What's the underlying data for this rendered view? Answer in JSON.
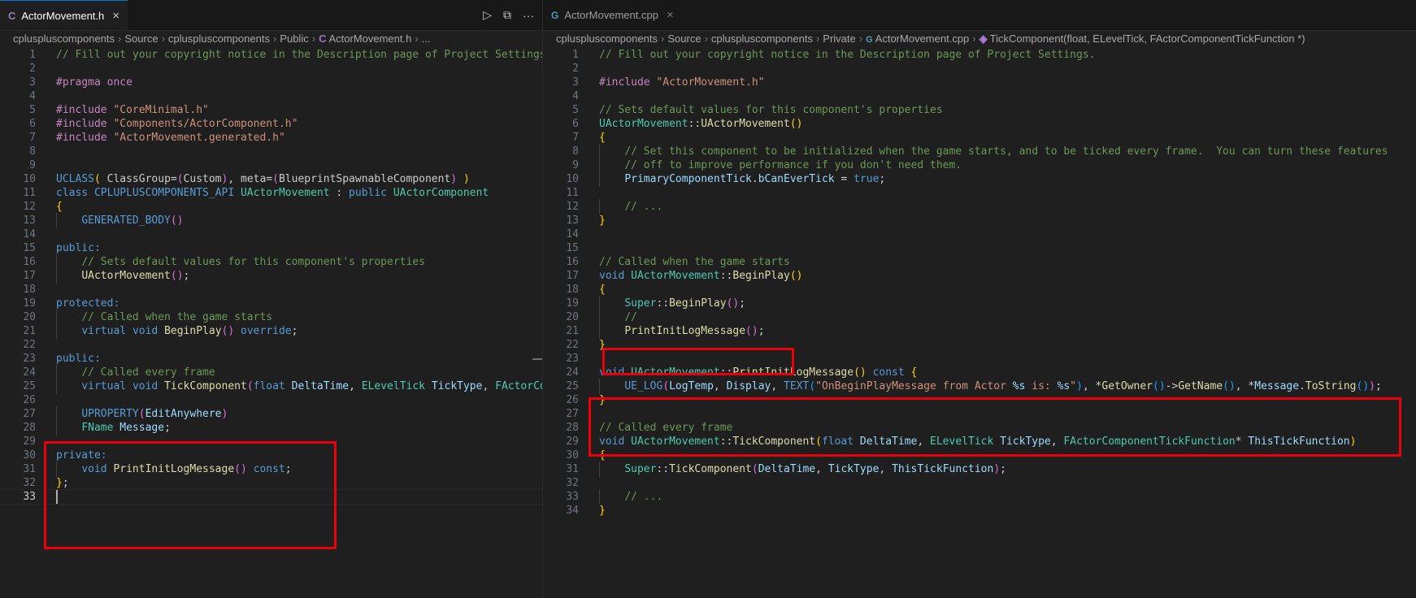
{
  "left_editor": {
    "tab": {
      "icon": "C",
      "label": "ActorMovement.h",
      "close": "×"
    },
    "actions": {
      "run": "▷",
      "split": "⧉",
      "more": "···"
    },
    "breadcrumb": [
      {
        "label": "cpluspluscomponents"
      },
      {
        "label": "Source"
      },
      {
        "label": "cpluspluscomponents"
      },
      {
        "label": "Public"
      },
      {
        "label": "ActorMovement.h",
        "icon": "C"
      },
      {
        "label": "..."
      }
    ],
    "lines": [
      [
        [
          "// Fill out your copyright notice in the Description page of Project Settings.",
          "t-cmt"
        ]
      ],
      [],
      [
        [
          "#pragma",
          "t-pp"
        ],
        [
          " "
        ],
        [
          "once",
          "t-pp"
        ]
      ],
      [],
      [
        [
          "#include",
          "t-pp"
        ],
        [
          " "
        ],
        [
          "\"CoreMinimal.h\"",
          "t-str"
        ]
      ],
      [
        [
          "#include",
          "t-pp"
        ],
        [
          " "
        ],
        [
          "\"Components/ActorComponent.h\"",
          "t-str"
        ]
      ],
      [
        [
          "#include",
          "t-pp"
        ],
        [
          " "
        ],
        [
          "\"ActorMovement.generated.h\"",
          "t-str"
        ]
      ],
      [],
      [],
      [
        [
          "UCLASS",
          "t-mac"
        ],
        [
          "(",
          "t-b1"
        ],
        [
          " ClassGroup=",
          "t-plain"
        ],
        [
          "(",
          "t-b2"
        ],
        [
          "Custom"
        ],
        [
          ")",
          "t-b2"
        ],
        [
          ", meta="
        ],
        [
          "(",
          "t-b2"
        ],
        [
          "BlueprintSpawnableComponent"
        ],
        [
          ")",
          "t-b2"
        ],
        [
          " "
        ],
        [
          ")",
          "t-b1"
        ]
      ],
      [
        [
          "class",
          "t-kw"
        ],
        [
          " "
        ],
        [
          "CPLUPLUSCOMPONENTS_API",
          "t-mac"
        ],
        [
          " "
        ],
        [
          "UActorMovement",
          "t-type"
        ],
        [
          " : "
        ],
        [
          "public",
          "t-kw"
        ],
        [
          " "
        ],
        [
          "UActorComponent",
          "t-type"
        ]
      ],
      [
        [
          "{",
          "t-b1"
        ]
      ],
      [
        [
          "    "
        ],
        [
          "GENERATED_BODY",
          "t-mac"
        ],
        [
          "()",
          "t-b2"
        ]
      ],
      [],
      [
        [
          "public:",
          "t-kw"
        ]
      ],
      [
        [
          "    "
        ],
        [
          "// Sets default values for this component's properties",
          "t-cmt"
        ]
      ],
      [
        [
          "    "
        ],
        [
          "UActorMovement",
          "t-fn"
        ],
        [
          "()",
          "t-b2"
        ],
        [
          ";"
        ]
      ],
      [],
      [
        [
          "protected:",
          "t-kw"
        ]
      ],
      [
        [
          "    "
        ],
        [
          "// Called when the game starts",
          "t-cmt"
        ]
      ],
      [
        [
          "    "
        ],
        [
          "virtual",
          "t-kw"
        ],
        [
          " "
        ],
        [
          "void",
          "t-kw"
        ],
        [
          " "
        ],
        [
          "BeginPlay",
          "t-fn"
        ],
        [
          "()",
          "t-b2"
        ],
        [
          " "
        ],
        [
          "override",
          "t-kw"
        ],
        [
          ";"
        ]
      ],
      [],
      [
        [
          "public:",
          "t-kw"
        ]
      ],
      [
        [
          "    "
        ],
        [
          "// Called every frame",
          "t-cmt"
        ]
      ],
      [
        [
          "    "
        ],
        [
          "virtual",
          "t-kw"
        ],
        [
          " "
        ],
        [
          "void",
          "t-kw"
        ],
        [
          " "
        ],
        [
          "TickComponent",
          "t-fn"
        ],
        [
          "(",
          "t-b2"
        ],
        [
          "float",
          "t-kw"
        ],
        [
          " "
        ],
        [
          "DeltaTime",
          "t-var"
        ],
        [
          ", "
        ],
        [
          "ELevelTick",
          "t-type"
        ],
        [
          " "
        ],
        [
          "TickType",
          "t-var"
        ],
        [
          ", "
        ],
        [
          "FActorCom",
          "t-type"
        ]
      ],
      [],
      [
        [
          "    "
        ],
        [
          "UPROPERTY",
          "t-mac"
        ],
        [
          "(",
          "t-b2"
        ],
        [
          "EditAnywhere",
          "t-var"
        ],
        [
          ")",
          "t-b2"
        ]
      ],
      [
        [
          "    "
        ],
        [
          "FName",
          "t-type"
        ],
        [
          " "
        ],
        [
          "Message",
          "t-var"
        ],
        [
          ";"
        ]
      ],
      [],
      [
        [
          "private:",
          "t-kw"
        ]
      ],
      [
        [
          "    "
        ],
        [
          "void",
          "t-kw"
        ],
        [
          " "
        ],
        [
          "PrintInitLogMessage",
          "t-fn"
        ],
        [
          "()",
          "t-b2"
        ],
        [
          " "
        ],
        [
          "const",
          "t-kw"
        ],
        [
          ";"
        ]
      ],
      [
        [
          "}",
          "t-b1"
        ],
        [
          ";"
        ]
      ],
      []
    ]
  },
  "right_editor": {
    "tab": {
      "icon": "G",
      "label": "ActorMovement.cpp",
      "close": "×"
    },
    "breadcrumb": [
      {
        "label": "cpluspluscomponents"
      },
      {
        "label": "Source"
      },
      {
        "label": "cpluspluscomponents"
      },
      {
        "label": "Private"
      },
      {
        "label": "ActorMovement.cpp",
        "icon": "G"
      },
      {
        "label": "TickComponent(float, ELevelTick, FActorComponentTickFunction *)",
        "icon": "◈"
      }
    ],
    "lines": [
      [
        [
          "// Fill out your copyright notice in the Description page of Project Settings.",
          "t-cmt"
        ]
      ],
      [],
      [
        [
          "#include",
          "t-pp"
        ],
        [
          " "
        ],
        [
          "\"ActorMovement.h\"",
          "t-str"
        ]
      ],
      [],
      [
        [
          "// Sets default values for this component's properties",
          "t-cmt"
        ]
      ],
      [
        [
          "UActorMovement",
          "t-type"
        ],
        [
          "::"
        ],
        [
          "UActorMovement",
          "t-fn"
        ],
        [
          "()",
          "t-b1"
        ]
      ],
      [
        [
          "{",
          "t-b1"
        ]
      ],
      [
        [
          "    "
        ],
        [
          "// Set this component to be initialized when the game starts, and to be ticked every frame.  You can turn these features",
          "t-cmt"
        ]
      ],
      [
        [
          "    "
        ],
        [
          "// off to improve performance if you don't need them.",
          "t-cmt"
        ]
      ],
      [
        [
          "    "
        ],
        [
          "PrimaryComponentTick",
          "t-var"
        ],
        [
          "."
        ],
        [
          "bCanEverTick",
          "t-var"
        ],
        [
          " = "
        ],
        [
          "true",
          "t-kw"
        ],
        [
          ";"
        ]
      ],
      [],
      [
        [
          "    "
        ],
        [
          "// ...",
          "t-cmt"
        ]
      ],
      [
        [
          "}",
          "t-b1"
        ]
      ],
      [],
      [],
      [
        [
          "// Called when the game starts",
          "t-cmt"
        ]
      ],
      [
        [
          "void",
          "t-kw"
        ],
        [
          " "
        ],
        [
          "UActorMovement",
          "t-type"
        ],
        [
          "::"
        ],
        [
          "BeginPlay",
          "t-fn"
        ],
        [
          "()",
          "t-b1"
        ]
      ],
      [
        [
          "{",
          "t-b1"
        ]
      ],
      [
        [
          "    "
        ],
        [
          "Super",
          "t-type"
        ],
        [
          "::"
        ],
        [
          "BeginPlay",
          "t-fn"
        ],
        [
          "()",
          "t-b2"
        ],
        [
          ";"
        ]
      ],
      [
        [
          "    "
        ],
        [
          "//",
          "t-cmt"
        ]
      ],
      [
        [
          "    "
        ],
        [
          "PrintInitLogMessage",
          "t-fn"
        ],
        [
          "()",
          "t-b2"
        ],
        [
          ";"
        ]
      ],
      [
        [
          "}",
          "t-b1"
        ]
      ],
      [],
      [
        [
          "void",
          "t-kw"
        ],
        [
          " "
        ],
        [
          "UActorMovement",
          "t-type"
        ],
        [
          "::"
        ],
        [
          "PrintInitLogMessage",
          "t-fn"
        ],
        [
          "()",
          "t-b1"
        ],
        [
          " "
        ],
        [
          "const",
          "t-kw"
        ],
        [
          " "
        ],
        [
          "{",
          "t-b1"
        ]
      ],
      [
        [
          "    "
        ],
        [
          "UE_LOG",
          "t-mac"
        ],
        [
          "(",
          "t-b2"
        ],
        [
          "LogTemp",
          "t-var"
        ],
        [
          ", "
        ],
        [
          "Display",
          "t-var"
        ],
        [
          ", "
        ],
        [
          "TEXT",
          "t-mac"
        ],
        [
          "(",
          "t-b3"
        ],
        [
          "\"OnBeginPlayMessage from Actor ",
          "t-str"
        ],
        [
          "%s",
          "t-fmt"
        ],
        [
          " is: ",
          "t-str"
        ],
        [
          "%s",
          "t-fmt"
        ],
        [
          "\"",
          "t-str"
        ],
        [
          ")",
          "t-b3"
        ],
        [
          ", *"
        ],
        [
          "GetOwner",
          "t-fn"
        ],
        [
          "()",
          "t-b3"
        ],
        [
          "->"
        ],
        [
          "GetName",
          "t-fn"
        ],
        [
          "()",
          "t-b3"
        ],
        [
          ", *"
        ],
        [
          "Message",
          "t-var"
        ],
        [
          "."
        ],
        [
          "ToString",
          "t-fn"
        ],
        [
          "()",
          "t-b3"
        ],
        [
          ")",
          "t-b2"
        ],
        [
          ";"
        ]
      ],
      [
        [
          "}",
          "t-b1"
        ]
      ],
      [],
      [
        [
          "// Called every frame",
          "t-cmt"
        ]
      ],
      [
        [
          "void",
          "t-kw"
        ],
        [
          " "
        ],
        [
          "UActorMovement",
          "t-type"
        ],
        [
          "::"
        ],
        [
          "TickComponent",
          "t-fn"
        ],
        [
          "(",
          "t-b1"
        ],
        [
          "float",
          "t-kw"
        ],
        [
          " "
        ],
        [
          "DeltaTime",
          "t-var"
        ],
        [
          ", "
        ],
        [
          "ELevelTick",
          "t-type"
        ],
        [
          " "
        ],
        [
          "TickType",
          "t-var"
        ],
        [
          ", "
        ],
        [
          "FActorComponentTickFunction",
          "t-type"
        ],
        [
          "* "
        ],
        [
          "ThisTickFunction",
          "t-var"
        ],
        [
          ")",
          "t-b1"
        ]
      ],
      [
        [
          "{",
          "t-b1"
        ]
      ],
      [
        [
          "    "
        ],
        [
          "Super",
          "t-type"
        ],
        [
          "::"
        ],
        [
          "TickComponent",
          "t-fn"
        ],
        [
          "(",
          "t-b2"
        ],
        [
          "DeltaTime",
          "t-var"
        ],
        [
          ", "
        ],
        [
          "TickType",
          "t-var"
        ],
        [
          ", "
        ],
        [
          "ThisTickFunction",
          "t-var"
        ],
        [
          ")",
          "t-b2"
        ],
        [
          ";"
        ]
      ],
      [],
      [
        [
          "    "
        ],
        [
          "// ...",
          "t-cmt"
        ]
      ],
      [
        [
          "}",
          "t-b1"
        ]
      ]
    ]
  },
  "colors": {
    "highlight_box": "#e8000b",
    "accent": "#0078d4"
  }
}
